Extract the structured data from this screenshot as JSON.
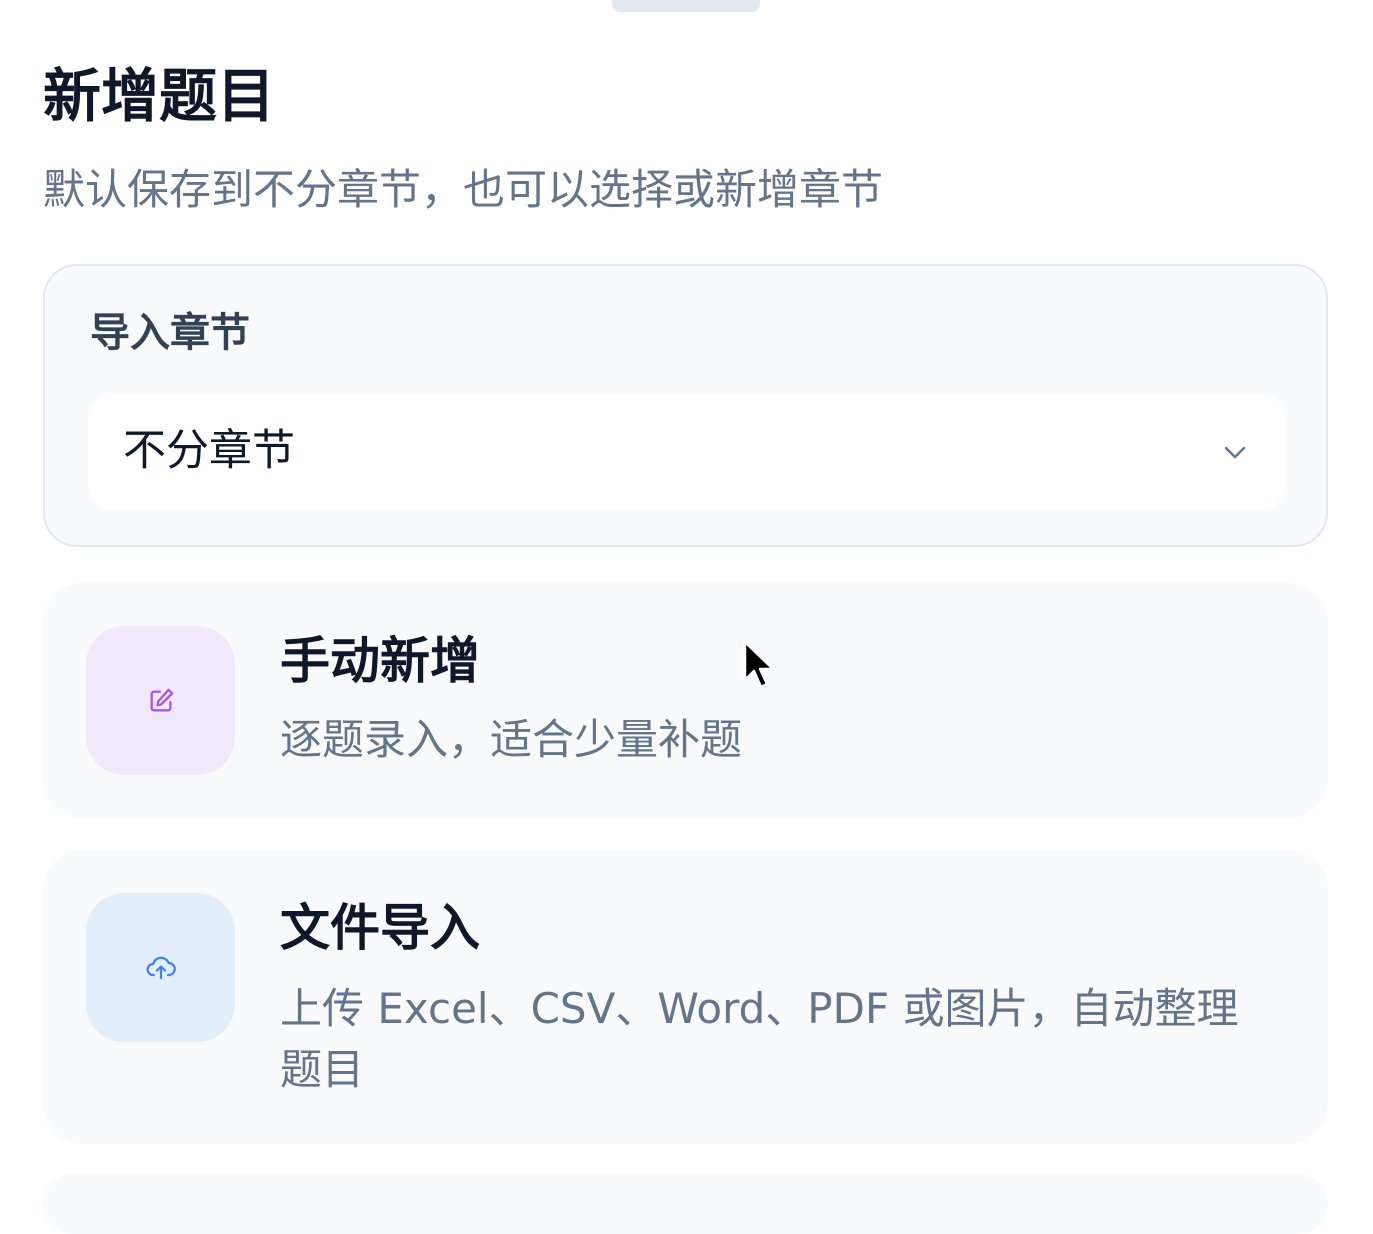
{
  "sheet": {
    "title": "新增题目",
    "subtitle": "默认保存到不分章节，也可以选择或新增章节"
  },
  "chapter": {
    "label": "导入章节",
    "selected": "不分章节"
  },
  "options": {
    "manual": {
      "title": "手动新增",
      "description": "逐题录入，适合少量补题",
      "icon": "edit-icon",
      "icon_color": "#a855f7",
      "tile_color": "#f3e8fb"
    },
    "file": {
      "title": "文件导入",
      "description": "上传 Excel、CSV、Word、PDF 或图片，自动整理题目",
      "icon": "cloud-upload-icon",
      "icon_color": "#3b82f6",
      "tile_color": "#e3eefb"
    }
  },
  "colors": {
    "title": "#0f172a",
    "muted": "#64748b",
    "card_bg": "#f8fafc",
    "card_border": "#e2e8f0"
  }
}
